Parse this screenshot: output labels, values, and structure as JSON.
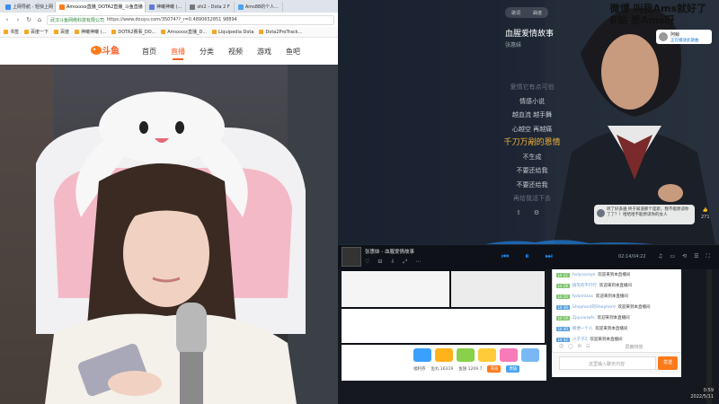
{
  "browser": {
    "tabs": [
      {
        "label": "上网导航 - 轻快上网 从这里开始",
        "color": "#3b8cf0"
      },
      {
        "label": "Amsxxxx直播_DOTA2直播_斗鱼直播",
        "color": "#ff7a1a",
        "active": true
      },
      {
        "label": "神曦神曦 (...",
        "color": "#5d7bd6"
      },
      {
        "label": "shi2 - Dota 2 F",
        "color": "#777777"
      },
      {
        "label": "Ams88的个人...",
        "color": "#4aa3f0"
      }
    ],
    "nav": {
      "back": "‹",
      "forward": "›",
      "refresh": "↻",
      "home": "⌂"
    },
    "address": {
      "site": "武汉斗鱼网络科技有限公司",
      "url": "https://www.douyu.com/35074??_r=0.4890652851 98894"
    },
    "bookmarks": [
      "书签",
      "百度一下",
      "百度",
      "神曦神曦 (...",
      "DOTA2赛事_DO...",
      "Amsxxxx直播_D...",
      "Liquipedia Dota",
      "Dota2ProTrack..."
    ]
  },
  "site": {
    "logo": "斗鱼",
    "nav": [
      "首页",
      "直播",
      "分类",
      "视频",
      "游戏",
      "鱼吧"
    ]
  },
  "music": {
    "toggle": [
      "歌词",
      "曲谱"
    ],
    "title": "血腥爱情故事",
    "artist": "张惠妹",
    "lyrics": [
      {
        "text": "爱情它有点可怕",
        "cls": "dim"
      },
      {
        "text": "情感小说",
        "cls": ""
      },
      {
        "text": "越血流 越手舞",
        "cls": ""
      },
      {
        "text": "心越空 再越痛",
        "cls": ""
      },
      {
        "text": "千刀万剐的恩情",
        "cls": "cur"
      },
      {
        "text": "不生成",
        "cls": ""
      },
      {
        "text": "不要还给我",
        "cls": ""
      },
      {
        "text": "不要还给我",
        "cls": ""
      },
      {
        "text": "再给我活下去",
        "cls": "dim"
      }
    ],
    "overlay": [
      "微博   叫我Ams就好了",
      "B站    是Ams呀"
    ],
    "user": {
      "name": "阿鲸",
      "sub": "正在播放此歌曲"
    },
    "comment": "听了好多遍 终于知道那个是新，我不能原谅你了了？！哈哈哈不能原谅你的女人",
    "likes": "271",
    "player": {
      "song": "张惠妹 - 血腥爱情故事",
      "time": "02:14/04:22",
      "prev": "⏮",
      "pause": "⏸",
      "next": "⏭",
      "icons": [
        "♡",
        "⊟",
        "⇩",
        "⤢",
        "⋯"
      ],
      "right": [
        "♫",
        "▭",
        "⟲",
        "☰",
        "⛶"
      ]
    }
  },
  "chat": {
    "rows": [
      {
        "lv": "LV 22",
        "user": "holycoceye",
        "text": "欢迎来到本直播间"
      },
      {
        "lv": "LV 28",
        "user": "搞笑的不行行",
        "text": "欢迎来到本直播间"
      },
      {
        "lv": "LV 20",
        "user": "fydxmlzxx",
        "text": "欢迎来到本直播间"
      },
      {
        "lv": "LV 36",
        "user": "Shepherd的Shepherd",
        "text": "欢迎来到本直播间"
      },
      {
        "lv": "LV 19",
        "user": "Zpyuanwfs",
        "text": "欢迎来到本直播间"
      },
      {
        "lv": "LV 40",
        "user": "随便一个人",
        "text": "欢迎来到本直播间"
      },
      {
        "lv": "LV 42",
        "user": "小子子Z",
        "text": "欢迎来到本直播间"
      }
    ],
    "tools": [
      "☺",
      "◯",
      "✉",
      "☷"
    ],
    "shield": "屏蔽特效",
    "placeholder": "这里输入聊天内容",
    "send": "发送"
  },
  "gifts": {
    "colors": [
      "#3aa0ff",
      "#ffb21a",
      "#8ad04a",
      "#ffcb3a",
      "#f77ab9",
      "#7ab8f5"
    ],
    "fish": "鱼丸 16319",
    "wealth": "鱼翅 1209.7",
    "recharge": "充值",
    "card": "贵族",
    "label": "福利券"
  },
  "clock": {
    "time": "0:59",
    "date": "2022/5/11"
  }
}
